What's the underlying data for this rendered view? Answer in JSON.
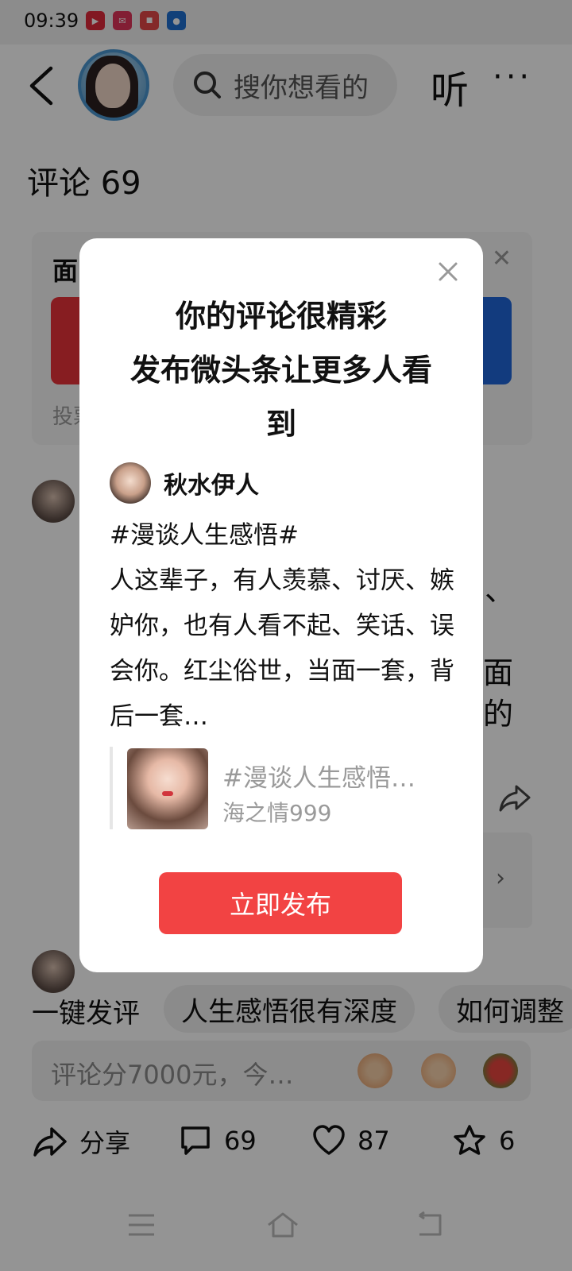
{
  "status_bar": {
    "time": "09:39"
  },
  "header": {
    "search_placeholder": "搜你想看的",
    "listen_label": "听",
    "more_label": "···"
  },
  "comments": {
    "title": "评论 69"
  },
  "vote_card": {
    "title_fragment": "面",
    "footer_fragment": "投票"
  },
  "background_fragments": {
    "line_a": "、",
    "line_b": "面",
    "line_c": "的",
    "reply_chevron": "›"
  },
  "chips": {
    "one_click": "一键发评",
    "chip_1": "人生感悟很有深度",
    "chip_2": "如何调整"
  },
  "comment_input": {
    "placeholder": "评论分7000元，今…"
  },
  "actions": {
    "share_label": "分享",
    "comment_count": "69",
    "like_count": "87",
    "favorite_count": "6"
  },
  "modal": {
    "title_line_1": "你的评论很精彩",
    "title_line_2": "发布微头条让更多人看",
    "title_line_3": "到",
    "username": "秋水伊人",
    "post_topic": "#漫谈人生感悟#",
    "post_body": "人这辈子，有人羡慕、讨厌、嫉妒你，也有人看不起、笑话、误会你。红尘俗世，当面一套，背后一套…",
    "quote_title": "#漫谈人生感悟…",
    "quote_author": "海之情999",
    "publish_label": "立即发布"
  },
  "colors": {
    "accent_red": "#f24343",
    "vote_red": "#e8333a",
    "vote_blue": "#1f66d9",
    "overlay": "rgba(0,0,0,0.42)"
  }
}
